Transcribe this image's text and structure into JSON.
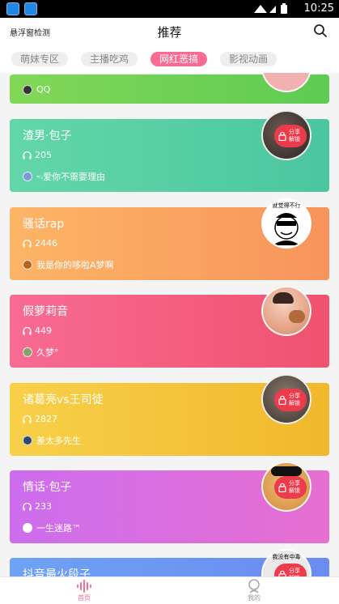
{
  "status": {
    "time": "10:25"
  },
  "header": {
    "left": "悬浮窗检测",
    "title": "推荐"
  },
  "tabs": [
    {
      "label": "萌妹专区",
      "active": false
    },
    {
      "label": "主播吃鸡",
      "active": false
    },
    {
      "label": "网红恶搞",
      "active": true
    },
    {
      "label": "影视动画",
      "active": false
    }
  ],
  "cards": [
    {
      "name": "",
      "plays": "",
      "author": "QQ",
      "gradient": [
        "#82d757",
        "#5ecb54"
      ]
    },
    {
      "name": "渣男·包子",
      "plays": "205",
      "author": "🖘爱你不需要理由",
      "gradient": [
        "#62d7a8",
        "#4cc6a0"
      ],
      "locked": true
    },
    {
      "name": "骚话rap",
      "plays": "2446",
      "author": "我是你的哆啦A梦啊",
      "gradient": [
        "#fdb566",
        "#f7945c"
      ],
      "avatar_caption": "就觉得不行"
    },
    {
      "name": "假萝莉音",
      "plays": "449",
      "author": "久梦°",
      "gradient": [
        "#f86b93",
        "#f0526f"
      ]
    },
    {
      "name": "诸葛亮vs王司徒",
      "plays": "2827",
      "author": "差太多先生",
      "gradient": [
        "#f8d04a",
        "#f0b82c"
      ],
      "locked": true
    },
    {
      "name": "情话·包子",
      "plays": "233",
      "author": "一生迷路™",
      "gradient": [
        "#cd6dee",
        "#e66fd0"
      ],
      "locked": true
    },
    {
      "name": "抖音最火段子",
      "plays": "",
      "author": "",
      "gradient": [
        "#6ea3f5",
        "#6b8bf0"
      ],
      "locked": true,
      "avatar_caption": "我没有中毒"
    }
  ],
  "lock_text": "分享解锁",
  "bottom_nav": [
    {
      "label": "首页",
      "active": true
    },
    {
      "label": "我的",
      "active": false
    }
  ],
  "colors": {
    "accent": "#f86b93",
    "lock": "#ee3b4c"
  }
}
